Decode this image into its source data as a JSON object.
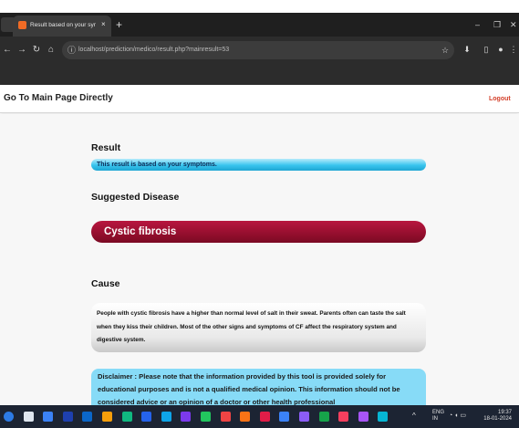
{
  "browser": {
    "tab_title": "Result based on your symptom",
    "tab_close": "×",
    "new_tab": "+",
    "minimize": "–",
    "restore": "❐",
    "close": "✕",
    "url": "localhost/prediction/medico/result.php?mainresult=53",
    "icons": [
      "back-icon",
      "forward-icon",
      "reload-icon",
      "home-icon",
      "site-info-icon",
      "star-icon",
      "downloads-icon",
      "sidebar-icon",
      "profile-icon",
      "menu-icon"
    ]
  },
  "nav": {
    "home_link": "Go To Main Page Directly",
    "logout": "Logout"
  },
  "result": {
    "heading": "Result",
    "note": "This result is based on your symptoms."
  },
  "suggested": {
    "heading": "Suggested Disease",
    "disease": "Cystic fibrosis"
  },
  "cause": {
    "heading": "Cause",
    "text": "People with cystic fibrosis have a higher than normal level of salt in their sweat. Parents often can taste the salt when they kiss their children. Most of the other signs and symptoms of CF affect the respiratory system and digestive system."
  },
  "disclaimer": {
    "text": "Disclaimer : Please note that the information provided by this tool is provided solely for educational purposes and is not a qualified medical opinion. This information should not be considered advice or an opinion of a doctor or other health professional"
  },
  "taskbar": {
    "language": "ENG",
    "language_sub": "IN",
    "time": "19:37",
    "date": "18-01-2024",
    "app_colors": [
      "#2d7be5",
      "#dfe6ef",
      "#3b82f6",
      "#1e40af",
      "#0b67c9",
      "#f59e0b",
      "#10b981",
      "#2563eb",
      "#0ea5e9",
      "#7c3aed",
      "#22c55e",
      "#ef4444",
      "#f97316",
      "#e11d48",
      "#3b82f6",
      "#8b5cf6",
      "#16a34a",
      "#f43f5e",
      "#a855f7",
      "#06b6d4"
    ],
    "colors": {
      "accent_blue": "#38c4ee",
      "disease_red": "#8e0d2b",
      "logout_red": "#d4402a"
    }
  }
}
